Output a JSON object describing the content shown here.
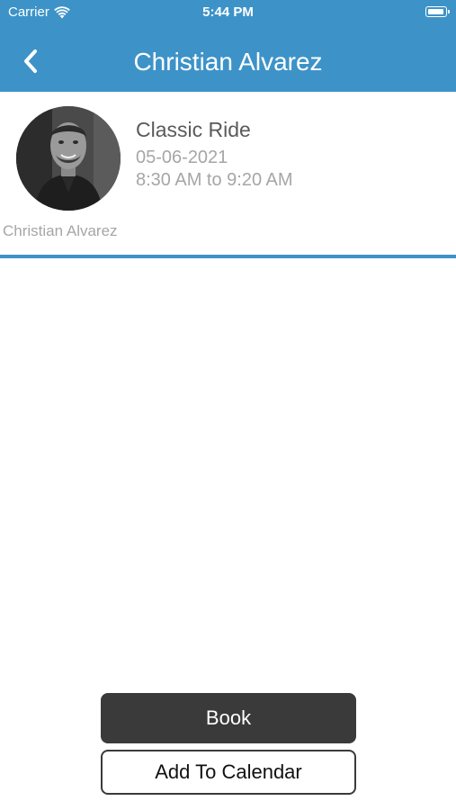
{
  "status_bar": {
    "carrier": "Carrier",
    "time": "5:44 PM"
  },
  "nav": {
    "title": "Christian Alvarez",
    "back_icon": "chevron-left-icon"
  },
  "class": {
    "name": "Classic Ride",
    "date": "05-06-2021",
    "time_range": "8:30 AM to 9:20 AM",
    "instructor": "Christian Alvarez"
  },
  "actions": {
    "book_label": "Book",
    "calendar_label": "Add To Calendar"
  },
  "colors": {
    "accent": "#3d93c8",
    "button_dark": "#3a3a3a",
    "text_primary": "#5a5a5a",
    "text_secondary": "#a6a6a6"
  }
}
